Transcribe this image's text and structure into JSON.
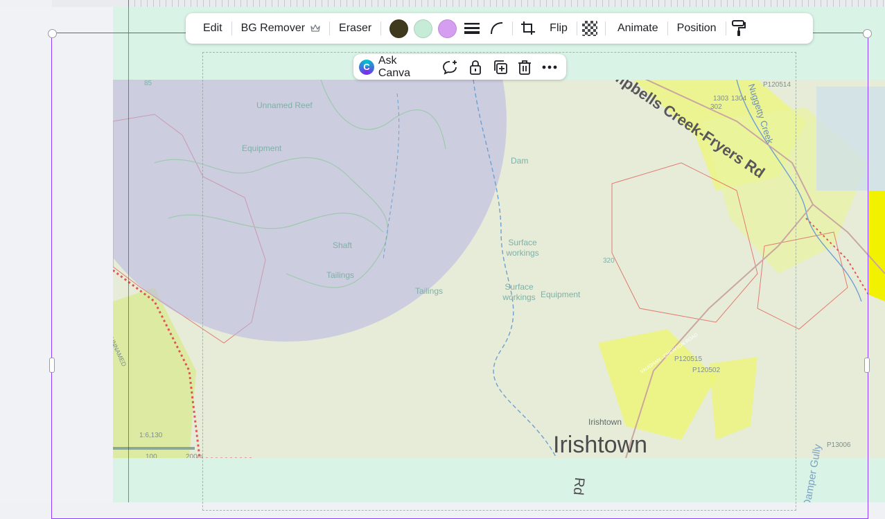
{
  "toolbar": {
    "edit": "Edit",
    "bg_remover": "BG Remover",
    "eraser": "Eraser",
    "flip": "Flip",
    "animate": "Animate",
    "position": "Position",
    "colors": [
      "#3f3a1e",
      "#c6ecd8",
      "#d59ef0"
    ]
  },
  "context": {
    "ask_canva": "Ask Canva"
  },
  "map": {
    "town_large": "Irishtown",
    "town_small": "Irishtown",
    "road_main": "Campbells Creek-Fryers Rd",
    "creek": "Nuggetty Creek",
    "gully": "Damper Gully",
    "road_small": "VAUGHAN - CHEWTON ROAD",
    "rd": "Rd",
    "labels": [
      "Unnamed Reef",
      "Equipment",
      "Dam",
      "Shaft",
      "Tailings",
      "Tailings",
      "Surface workings",
      "Surface workings",
      "Equipment",
      "320",
      "P120515",
      "P120502",
      "P120514",
      "1303",
      "1304",
      "302",
      "85",
      "1:6,130",
      "100",
      "200m",
      "P13006",
      "UNNAMED"
    ]
  },
  "icons": [
    "crown-icon",
    "line-weight-icon",
    "corner-radius-icon",
    "crop-icon",
    "transparency-icon",
    "paint-roller-icon",
    "comment-add-icon",
    "lock-icon",
    "duplicate-icon",
    "trash-icon",
    "more-icon"
  ]
}
